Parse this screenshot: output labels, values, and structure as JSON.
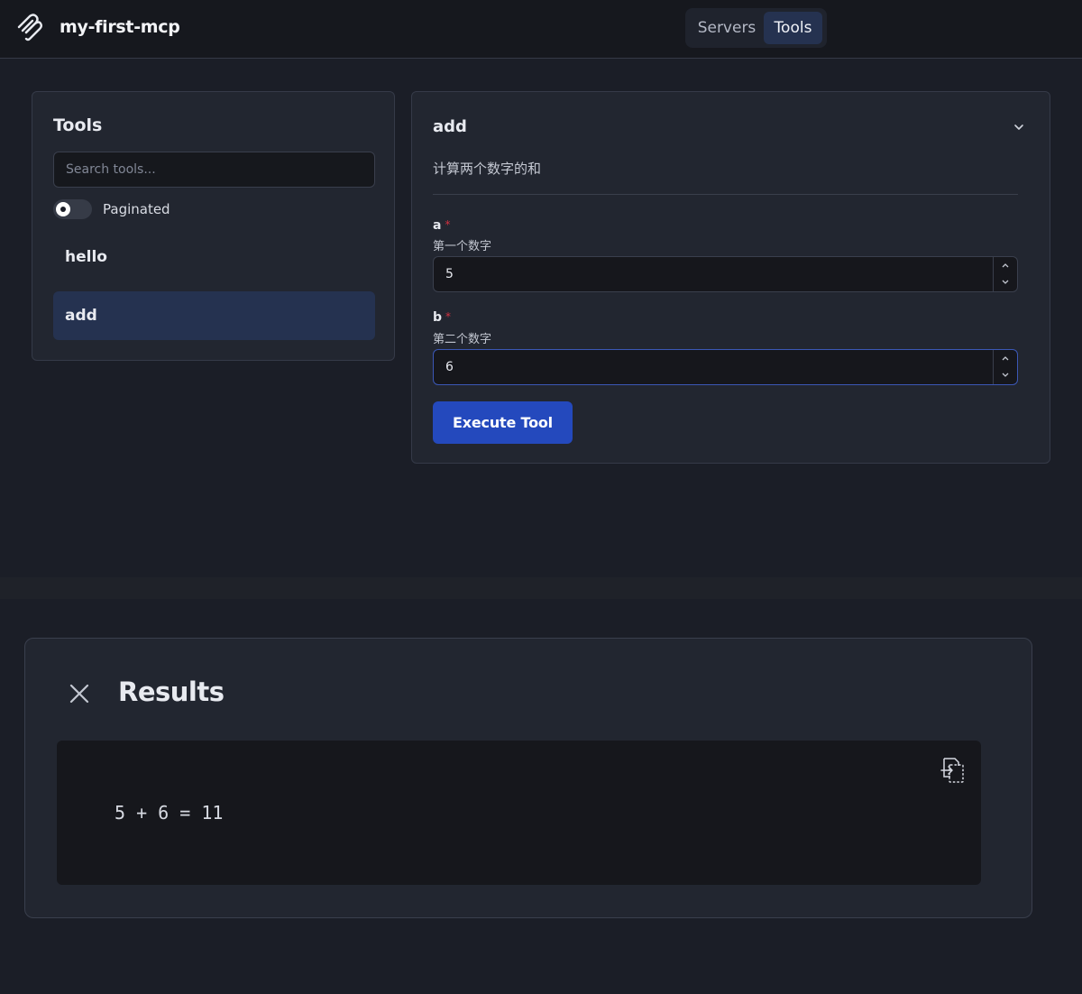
{
  "header": {
    "app_title": "my-first-mcp",
    "logo_icon": "mcp-logo-icon",
    "tabs": [
      {
        "label": "Servers",
        "active": false
      },
      {
        "label": "Tools",
        "active": true
      }
    ]
  },
  "tools_panel": {
    "title": "Tools",
    "search_placeholder": "Search tools...",
    "paginated_label": "Paginated",
    "paginated_on": false,
    "items": [
      {
        "label": "hello",
        "selected": false
      },
      {
        "label": "add",
        "selected": true
      }
    ]
  },
  "tool_detail": {
    "name": "add",
    "description": "计算两个数字的和",
    "collapse_icon": "chevron-down-icon",
    "fields": [
      {
        "name": "a",
        "required_mark": "*",
        "description": "第一个数字",
        "value": "5"
      },
      {
        "name": "b",
        "required_mark": "*",
        "description": "第二个数字",
        "value": "6"
      }
    ],
    "execute_label": "Execute Tool"
  },
  "results": {
    "title": "Results",
    "output": "5 + 6 = 11",
    "close_icon": "close-icon",
    "copy_icon": "copy-icon"
  },
  "colors": {
    "background": "#1b1e27",
    "panel": "#222630",
    "accent": "#2449bd",
    "selected": "#253250",
    "required": "#d2313f"
  }
}
